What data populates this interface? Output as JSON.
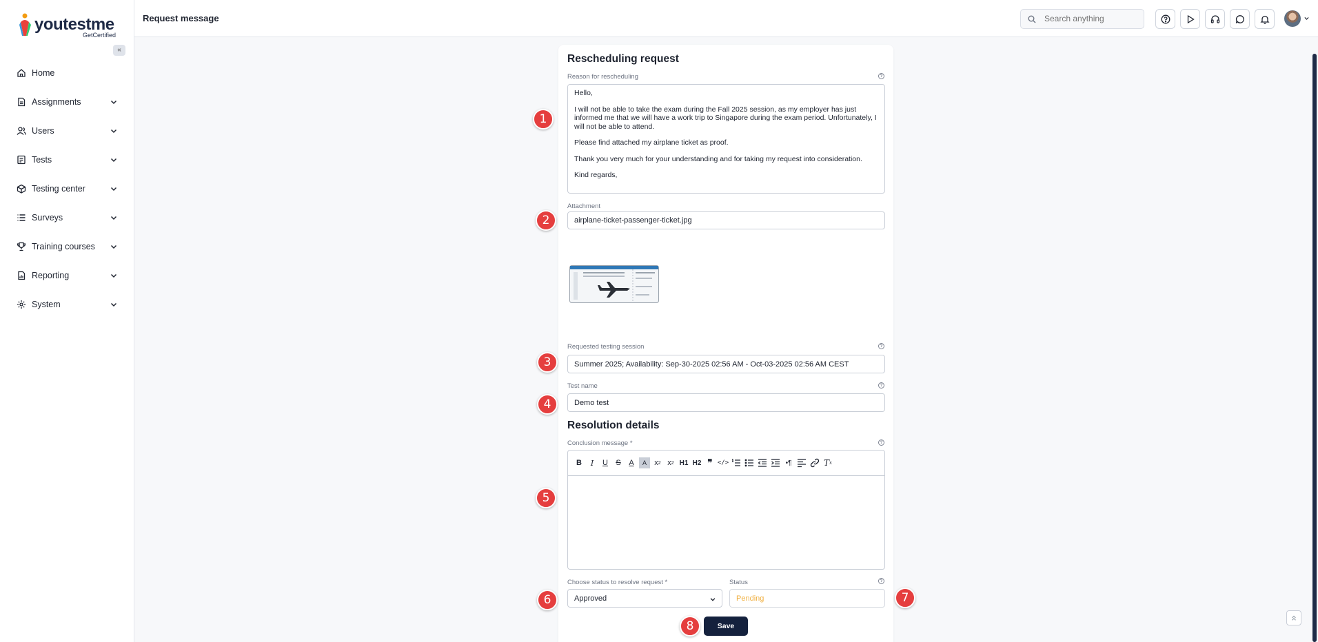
{
  "app": {
    "logo_text_main": "youtestme",
    "logo_text_sub": "GetCertified"
  },
  "header": {
    "title": "Request message",
    "search_placeholder": "Search anything"
  },
  "sidebar": {
    "items": [
      {
        "label": "Home",
        "icon": "home-icon"
      },
      {
        "label": "Assignments",
        "icon": "document-icon"
      },
      {
        "label": "Users",
        "icon": "users-icon"
      },
      {
        "label": "Tests",
        "icon": "test-icon"
      },
      {
        "label": "Testing center",
        "icon": "cube-icon"
      },
      {
        "label": "Surveys",
        "icon": "list-icon"
      },
      {
        "label": "Training courses",
        "icon": "trophy-icon"
      },
      {
        "label": "Reporting",
        "icon": "report-icon"
      },
      {
        "label": "System",
        "icon": "gear-icon"
      }
    ]
  },
  "form": {
    "rescheduling_title": "Rescheduling request",
    "reason_label": "Reason for rescheduling",
    "reason_paragraphs": [
      "Hello,",
      "I will not be able to take the exam during the Fall 2025 session, as my employer has just informed me that we will have a work trip to Singapore during the exam period. Unfortunately, I will not be able to attend.",
      "Please find attached my airplane ticket as proof.",
      "Thank you very much for your understanding and for taking my request into consideration.",
      "Kind regards,"
    ],
    "attachment_label": "Attachment",
    "attachment_value": "airplane-ticket-passenger-ticket.jpg",
    "session_label": "Requested testing session",
    "session_value": "Summer 2025; Availability: Sep-30-2025 02:56 AM - Oct-03-2025 02:56 AM CEST",
    "test_name_label": "Test name",
    "test_name_value": "Demo test",
    "resolution_title": "Resolution details",
    "conclusion_label": "Conclusion message *",
    "choose_status_label": "Choose status to resolve request *",
    "choose_status_value": "Approved",
    "status_label": "Status",
    "status_value": "Pending",
    "save_label": "Save"
  },
  "markers": [
    "1",
    "2",
    "3",
    "4",
    "5",
    "6",
    "7",
    "8"
  ],
  "colors": {
    "marker": "#e53e3e",
    "primary_button": "#14213d",
    "pending_status": "#f0b041"
  }
}
